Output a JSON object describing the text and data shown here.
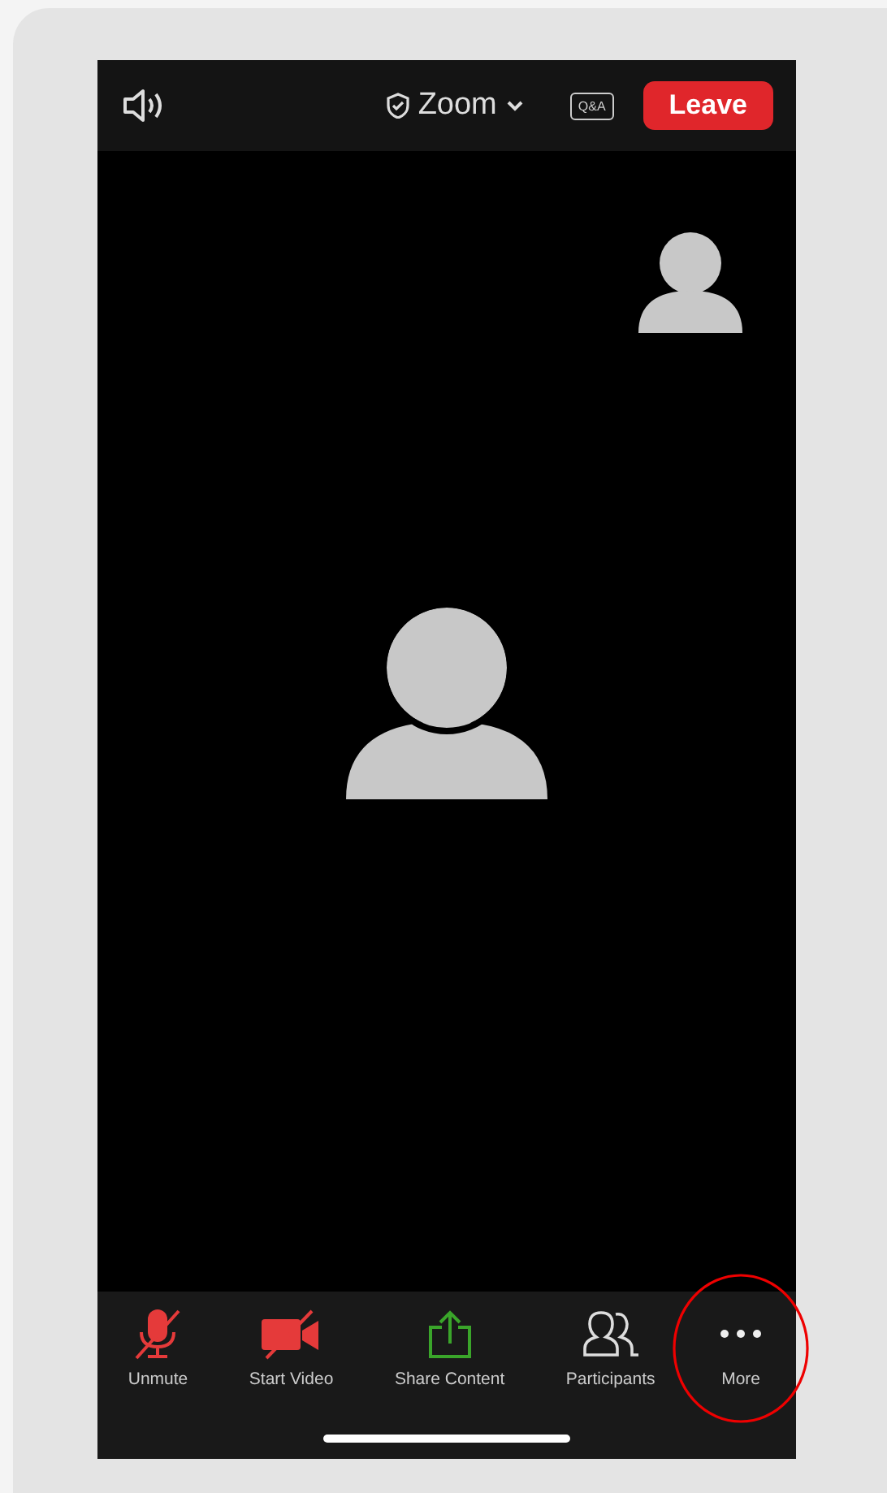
{
  "top_bar": {
    "title": "Zoom",
    "qa_label": "Q&A",
    "leave_label": "Leave"
  },
  "toolbar": [
    {
      "kind": "mic",
      "label": "Unmute",
      "circled": false
    },
    {
      "kind": "video",
      "label": "Start Video",
      "circled": false
    },
    {
      "kind": "share",
      "label": "Share Content",
      "circled": false
    },
    {
      "kind": "participants",
      "label": "Participants",
      "circled": false
    },
    {
      "kind": "more",
      "label": "More",
      "circled": true
    }
  ]
}
